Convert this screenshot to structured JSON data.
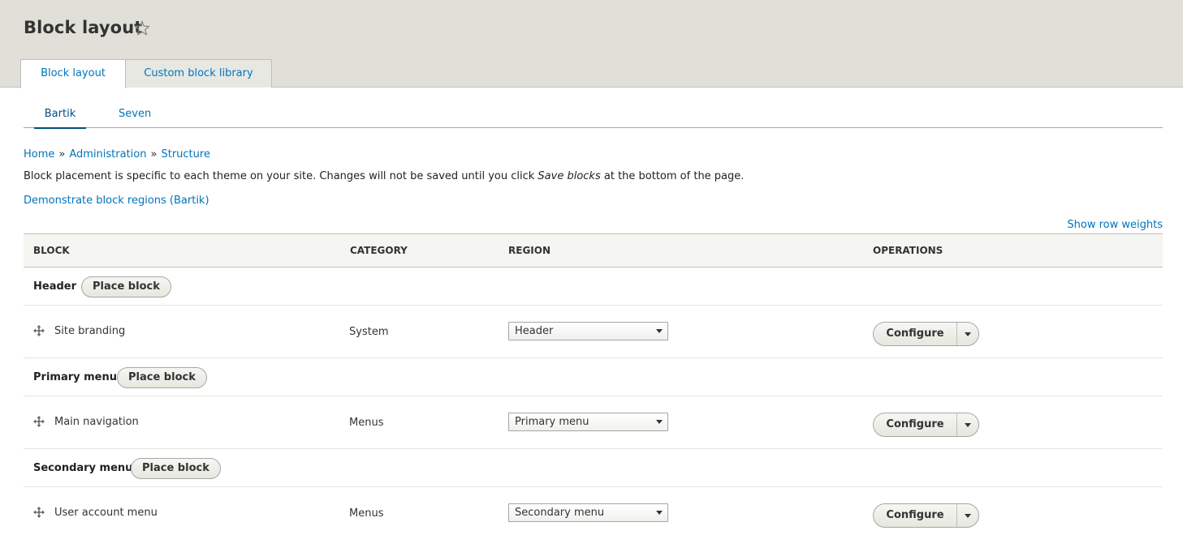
{
  "page": {
    "title": "Block layout"
  },
  "tabs": [
    {
      "label": "Block layout",
      "active": true
    },
    {
      "label": "Custom block library",
      "active": false
    }
  ],
  "subtabs": [
    {
      "label": "Bartik",
      "active": true
    },
    {
      "label": "Seven",
      "active": false
    }
  ],
  "breadcrumb": {
    "items": [
      "Home",
      "Administration",
      "Structure"
    ],
    "separator": "»"
  },
  "description": {
    "before": "Block placement is specific to each theme on your site. Changes will not be saved until you click ",
    "emphasis": "Save blocks",
    "after": " at the bottom of the page."
  },
  "demo_link": "Demonstrate block regions (Bartik)",
  "row_weights_link": "Show row weights",
  "table": {
    "headers": {
      "block": "BLOCK",
      "category": "CATEGORY",
      "region": "REGION",
      "operations": "OPERATIONS"
    },
    "place_block_label": "Place block",
    "configure_label": "Configure",
    "regions": [
      {
        "title": "Header",
        "block": {
          "name": "Site branding",
          "category": "System",
          "region": "Header"
        }
      },
      {
        "title": "Primary menu",
        "block": {
          "name": "Main navigation",
          "category": "Menus",
          "region": "Primary menu"
        }
      },
      {
        "title": "Secondary menu",
        "block": {
          "name": "User account menu",
          "category": "Menus",
          "region": "Secondary menu"
        }
      }
    ]
  },
  "colors": {
    "link": "#0074bd",
    "header_bg": "#e0e0d8",
    "table_header_bg": "#f5f5f2"
  },
  "icons": {
    "favorite": "star-outline-icon",
    "drag": "move-arrows-icon",
    "dropdown": "caret-down-icon"
  }
}
